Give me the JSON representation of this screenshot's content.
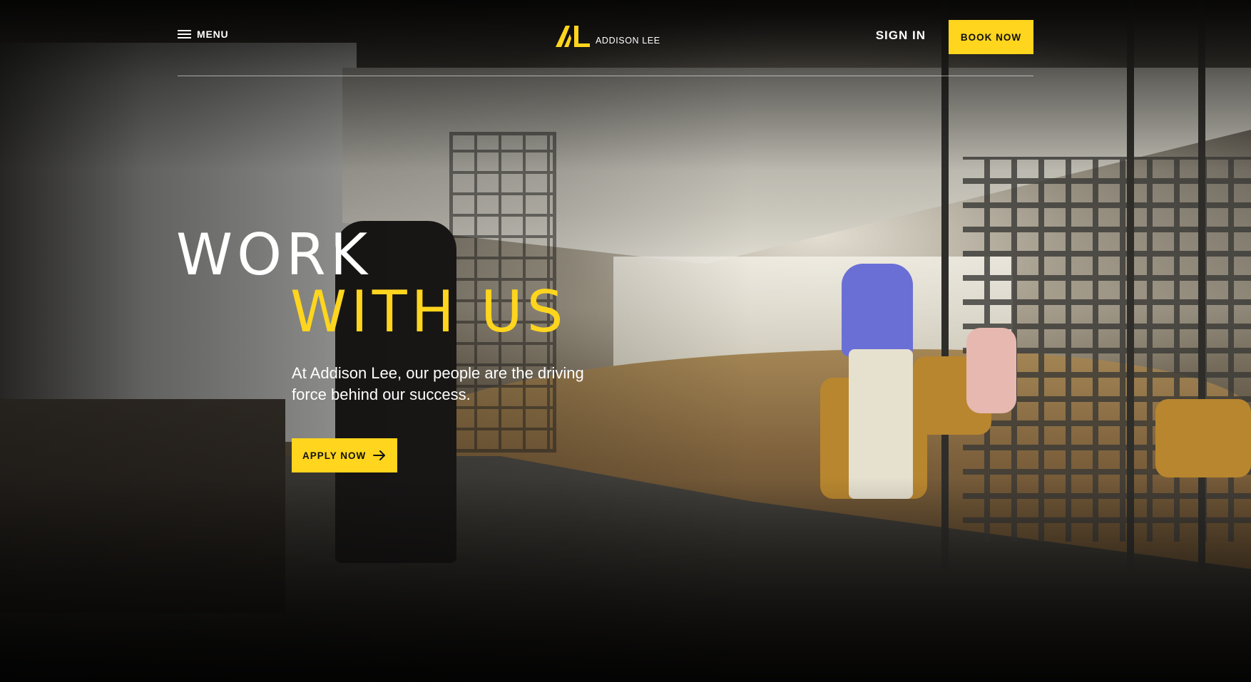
{
  "header": {
    "menu_label": "MENU",
    "logo_text": "ADDISON LEE",
    "sign_in_label": "SIGN IN",
    "book_now_label": "BOOK NOW"
  },
  "hero": {
    "title_line1": "WORK",
    "title_line2": "WITH US",
    "subtitle": "At Addison Lee, our people are the driving force behind our success.",
    "cta_label": "APPLY NOW"
  },
  "colors": {
    "accent_yellow": "#ffd51d",
    "text_white": "#ffffff",
    "text_dark": "#111111"
  },
  "icons": {
    "menu": "hamburger-icon",
    "logo": "al-logo-mark",
    "cta": "arrow-right-icon"
  }
}
